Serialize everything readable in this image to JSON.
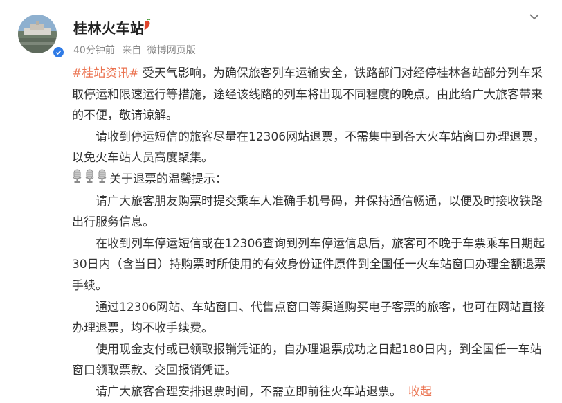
{
  "post": {
    "username": "桂林火车站",
    "user_icon": "red-pepper-icon",
    "meta": {
      "time": "40分钟前",
      "source_prefix": "来自",
      "source": "微博网页版"
    },
    "hashtag": "#桂站资讯#",
    "intro": "受天气影响，为确保旅客列车运输安全，铁路部门对经停桂林各站部分列车采取停运和限速运行等措施，途经该线路的列车将出现不同程度的晚点。由此给广大旅客带来的不便，敬请谅解。",
    "para1": "请收到停运短信的旅客尽量在12306网站退票，不需集中到各大火车站窗口办理退票，以免火车站人员高度聚集。",
    "tips_title": "关于退票的温馨提示：",
    "tips_icon": "microphone-icon",
    "tip1": "请广大旅客朋友购票时提交乘车人准确手机号码，并保持通信畅通，以便及时接收铁路出行服务信息。",
    "tip2": "在收到列车停运短信或在12306查询到列车停运信息后，旅客可不晚于车票乘车日期起30日内（含当日）持购票时所使用的有效身份证件原件到全国任一火车站窗口办理全额退票手续。",
    "tip3": "通过12306网站、车站窗口、代售点窗口等渠道购买电子客票的旅客，也可在网站直接办理退票，均不收手续费。",
    "tip4": "使用现金支付或已领取报销凭证的，自办理退票成功之日起180日内，到全国任一车站窗口领取票款、交回报销凭证。",
    "tip5": "请广大旅客合理安排退票时间，不需立即前往火车站退票。",
    "collapse_label": "收起"
  },
  "colors": {
    "link": "#eb7350",
    "text": "#333333",
    "meta": "#888888",
    "verified": "#2f7be6"
  }
}
